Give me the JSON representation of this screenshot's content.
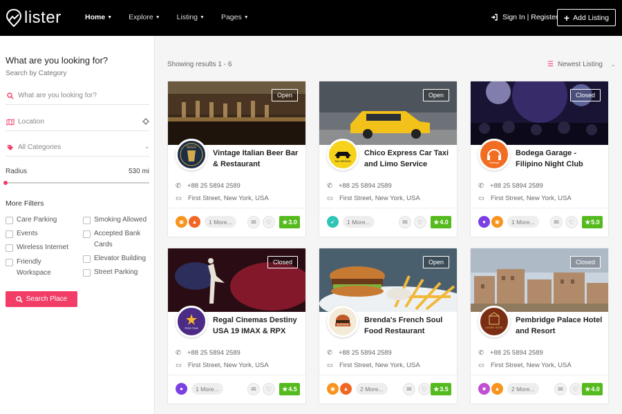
{
  "header": {
    "logo_text": "lister",
    "nav": [
      {
        "label": "Home",
        "active": true
      },
      {
        "label": "Explore",
        "active": false
      },
      {
        "label": "Listing",
        "active": false
      },
      {
        "label": "Pages",
        "active": false
      }
    ],
    "signin_label": "Sign In | Register",
    "add_listing_label": "Add Listing"
  },
  "sidebar": {
    "title": "What are you looking for?",
    "subtitle": "Search by Category",
    "search_placeholder": "What are you looking for?",
    "location_placeholder": "Location",
    "category_value": "All Categories",
    "radius_label": "Radius",
    "radius_value": "530 mi",
    "radius_fraction": 0.0,
    "more_filters_label": "More Filters",
    "filters_left": [
      "Care Parking",
      "Events",
      "Wireless Internet",
      "Friendly Workspace"
    ],
    "filters_right": [
      "Smoking Allowed",
      "Accepted Bank Cards",
      "Elevator Building",
      "Street Parking"
    ],
    "search_button": "Search Place"
  },
  "results": {
    "text": "Showing results 1 - 6",
    "sort_label": "Newest Listing"
  },
  "listings": [
    {
      "title": "Vintage Italian Beer Bar & Restaurant",
      "status": "Open",
      "phone": "+88 25 5894 2589",
      "address": "First Street, New York, USA",
      "more": "1 More...",
      "rating": "3.0",
      "icons": [
        "cup-icon",
        "thumb-icon"
      ]
    },
    {
      "title": "Chico Express Car Taxi and Limo Service",
      "status": "Open",
      "phone": "+88 25 5894 2589",
      "address": "First Street, New York, USA",
      "more": "1 More...",
      "rating": "4.0",
      "icons": [
        "rocket-icon"
      ]
    },
    {
      "title": "Bodega Garage - Filipino Night Club",
      "status": "Closed",
      "phone": "+88 25 5894 2589",
      "address": "First Street, New York, USA",
      "more": "1 More...",
      "rating": "5.0",
      "icons": [
        "mic-icon",
        "cup-icon"
      ]
    },
    {
      "title": "Regal Cinemas Destiny USA 19 IMAX & RPX",
      "status": "Closed",
      "phone": "+88 25 5894 2589",
      "address": "First Street, New York, USA",
      "more": "1 More...",
      "rating": "4.5",
      "icons": [
        "mic-icon"
      ]
    },
    {
      "title": "Brenda's French Soul Food Restaurant",
      "status": "Open",
      "phone": "+88 25 5894 2589",
      "address": "First Street, New York, USA",
      "more": "2 More...",
      "rating": "3.5",
      "icons": [
        "cup-icon",
        "thumb-icon"
      ]
    },
    {
      "title": "Pembridge Palace Hotel and Resort",
      "status": "Closed",
      "phone": "+88 25 5894 2589",
      "address": "First Street, New York, USA",
      "more": "2 More...",
      "rating": "4.0",
      "icons": [
        "car-icon",
        "thumb-icon"
      ]
    }
  ],
  "logos": [
    "BEER",
    "TAXI SERVICE",
    "Bodega",
    "PIZZ FILM",
    "BURGER",
    "LUXURY HOTEL"
  ],
  "colors": {
    "accent": "#f23d66",
    "rating": "#54ba1d",
    "header": "#000000"
  }
}
